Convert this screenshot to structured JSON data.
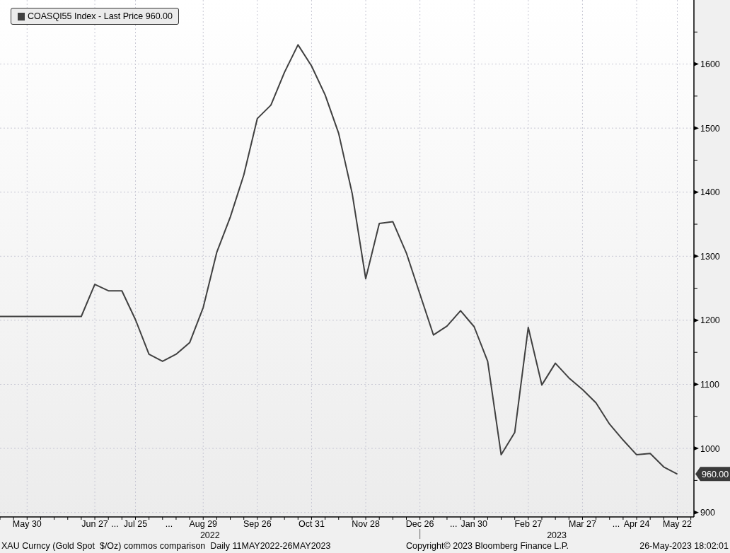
{
  "legend": {
    "text": "COASQI55 Index - Last Price 960.00",
    "color": "#404040"
  },
  "chart_data": {
    "type": "line",
    "categories": [
      null,
      null,
      "May 30",
      null,
      null,
      null,
      null,
      "Jun 27",
      "...",
      null,
      "Jul 25",
      null,
      "...",
      null,
      null,
      "Aug 29",
      null,
      null,
      null,
      "Sep 26",
      null,
      null,
      null,
      "Oct 31",
      null,
      null,
      null,
      "Nov 28",
      null,
      null,
      null,
      "Dec 26",
      null,
      "...",
      null,
      "Jan 30",
      null,
      null,
      null,
      "Feb 27",
      null,
      null,
      null,
      "Mar 27",
      null,
      "...",
      null,
      "Apr 24",
      null,
      null,
      "May 22"
    ],
    "series": [
      {
        "color": "#404040",
        "values": [
          1206,
          1206,
          1206,
          1206,
          1206,
          1206,
          1206,
          1256,
          1246,
          1246,
          1201,
          1147,
          1136,
          1147,
          1165,
          1220,
          1306,
          1361,
          1427,
          1515,
          1536,
          1587,
          1630,
          1597,
          1552,
          1492,
          1398,
          1265,
          1351,
          1354,
          1305,
          1241,
          1177,
          1191,
          1215,
          1190,
          1136,
          990,
          1025,
          1189,
          1099,
          1133,
          1110,
          1092,
          1071,
          1038,
          1013,
          990,
          992,
          971,
          960
        ]
      }
    ],
    "ylim": [
      893,
      1700
    ],
    "yticks": [
      900,
      1000,
      1100,
      1200,
      1300,
      1400,
      1500,
      1600
    ],
    "grid": true
  },
  "year_labels": [
    "2022",
    "2023"
  ],
  "last_value_tag": "960.00",
  "footer": {
    "description": "XAU Curncy (Gold Spot  $/Oz) commos comparison  Daily 11MAY2022-26MAY2023",
    "copyright": "Copyright© 2023 Bloomberg Finance L.P.",
    "timestamp": "26-May-2023 18:02:01"
  }
}
